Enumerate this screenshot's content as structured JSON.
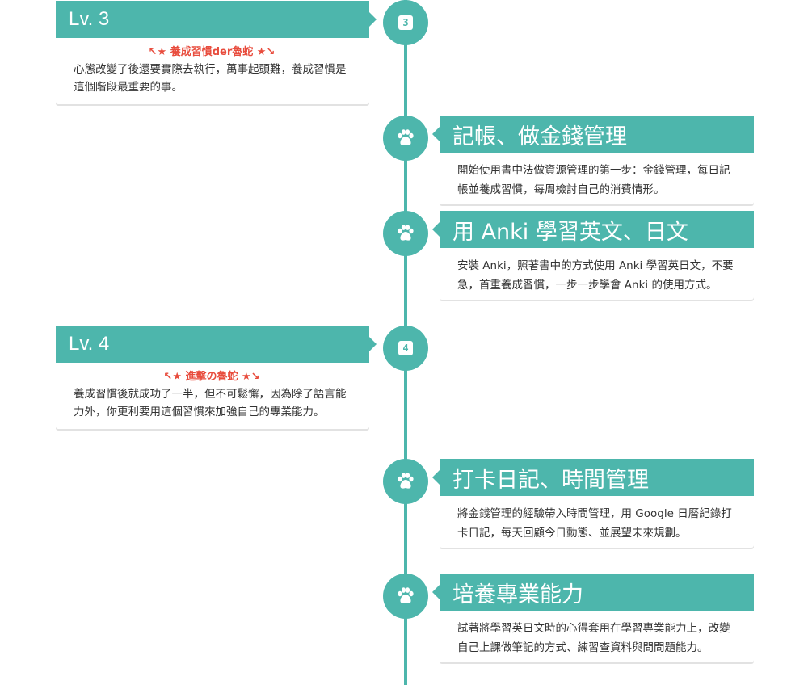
{
  "colors": {
    "accent": "#4db6ac",
    "subtitle": "#e84c3d",
    "text": "#333333"
  },
  "levels": [
    {
      "title": "Lv. 3",
      "badge": "3",
      "subtitle": "↖★ 養成習慣der魯蛇 ★↘",
      "text": "心態改變了後還要實際去執行，萬事起頭難，養成習慣是這個階段最重要的事。"
    },
    {
      "title": "Lv. 4",
      "badge": "4",
      "subtitle": "↖★ 進擊の魯蛇 ★↘",
      "text": "養成習慣後就成功了一半，但不可鬆懈，因為除了語言能力外，你更利要用這個習慣來加強自己的專業能力。"
    }
  ],
  "items": [
    {
      "icon": "paw-icon",
      "title": "記帳、做金錢管理",
      "text": "開始使用書中法做資源管理的第一步：金錢管理，每日記帳並養成習慣，每周檢討自己的消費情形。"
    },
    {
      "icon": "paw-icon",
      "title": "用 Anki 學習英文、日文",
      "text": "安裝 Anki，照著書中的方式使用 Anki 學習英日文，不要急，首重養成習慣，一步一步學會 Anki 的使用方式。"
    },
    {
      "icon": "paw-icon",
      "title": "打卡日記、時間管理",
      "text": "將金錢管理的經驗帶入時間管理，用 Google 日曆紀錄打卡日記，每天回顧今日動態、並展望未來規劃。"
    },
    {
      "icon": "paw-icon",
      "title": "培養專業能力",
      "text": "試著將學習英日文時的心得套用在學習專業能力上，改變自己上課做筆記的方式、練習查資料與問問題能力。"
    }
  ]
}
